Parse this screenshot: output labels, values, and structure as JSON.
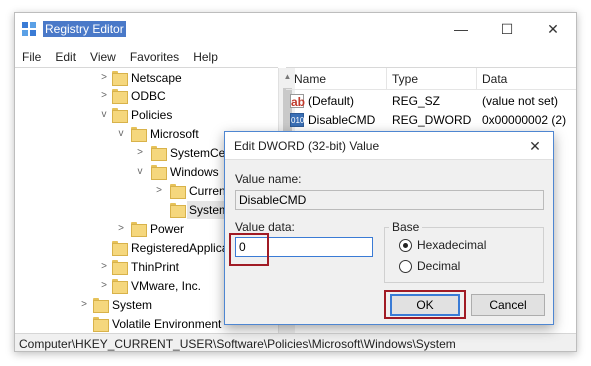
{
  "window": {
    "title": "Registry Editor",
    "controls": {
      "minimize": "—",
      "maximize": "☐",
      "close": "✕"
    }
  },
  "menu": [
    "File",
    "Edit",
    "View",
    "Favorites",
    "Help"
  ],
  "tree": {
    "items": [
      {
        "label": "Netscape",
        "expander": ">"
      },
      {
        "label": "ODBC",
        "expander": ">"
      },
      {
        "label": "Policies",
        "expander": "v"
      },
      {
        "label": "Microsoft",
        "expander": "v"
      },
      {
        "label": "SystemCertif",
        "expander": ">"
      },
      {
        "label": "Windows",
        "expander": "v"
      },
      {
        "label": "CurrentVe",
        "expander": ">"
      },
      {
        "label": "System",
        "expander": "",
        "selected": true
      },
      {
        "label": "Power",
        "expander": ">"
      },
      {
        "label": "RegisteredApplicatio",
        "expander": ""
      },
      {
        "label": "ThinPrint",
        "expander": ">"
      },
      {
        "label": "VMware, Inc.",
        "expander": ">"
      },
      {
        "label": "System",
        "expander": ">"
      },
      {
        "label": "Volatile Environment",
        "expander": ""
      }
    ]
  },
  "list": {
    "columns": {
      "name": "Name",
      "type": "Type",
      "data": "Data"
    },
    "rows": [
      {
        "icon": "ab",
        "name": "(Default)",
        "type": "REG_SZ",
        "data": "(value not set)"
      },
      {
        "icon": "010",
        "name": "DisableCMD",
        "type": "REG_DWORD",
        "data": "0x00000002 (2)"
      }
    ]
  },
  "statusbar": {
    "path": "Computer\\HKEY_CURRENT_USER\\Software\\Policies\\Microsoft\\Windows\\System"
  },
  "dialog": {
    "title": "Edit DWORD (32-bit) Value",
    "close": "✕",
    "value_name_label": "Value name:",
    "value_name": "DisableCMD",
    "value_data_label": "Value data:",
    "value_data": "0",
    "base_label": "Base",
    "base_options": [
      {
        "label": "Hexadecimal",
        "selected": true
      },
      {
        "label": "Decimal",
        "selected": false
      }
    ],
    "ok_label": "OK",
    "cancel_label": "Cancel"
  },
  "colors": {
    "highlight": "#a01b25",
    "accent": "#3a7bd5",
    "folder": "#f5d77d"
  },
  "icons": [
    "registry-icon",
    "folder-icon",
    "chevron-right-icon",
    "chevron-down-icon",
    "string-value-icon",
    "dword-value-icon",
    "close-icon"
  ]
}
